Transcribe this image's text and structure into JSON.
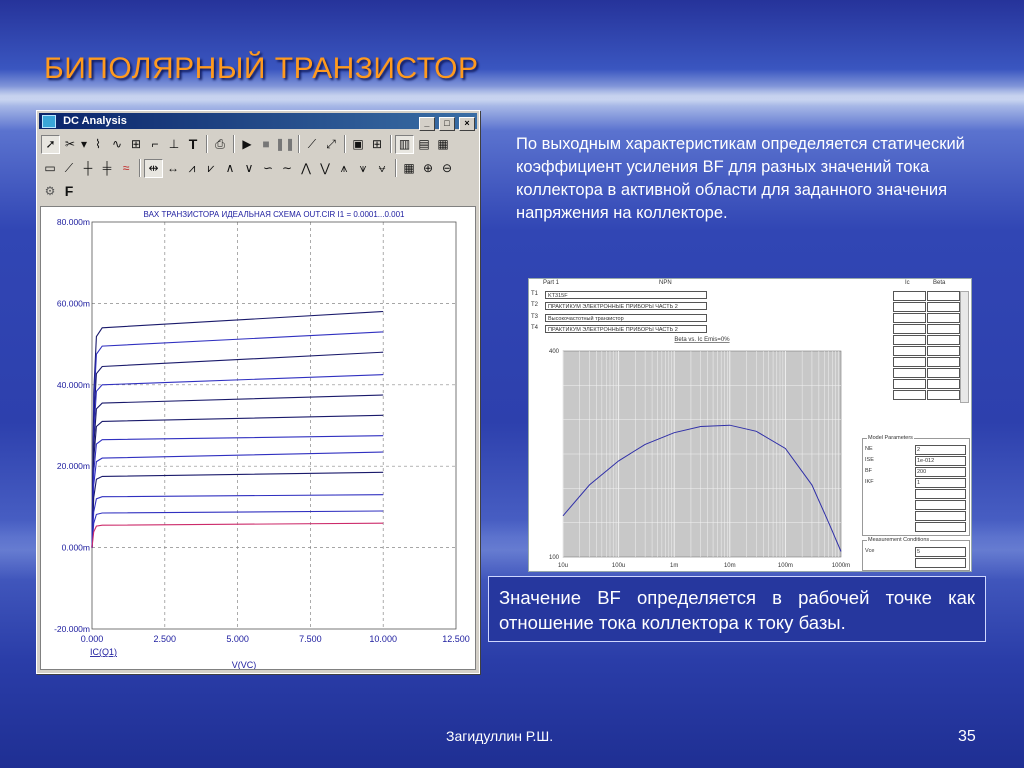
{
  "slide": {
    "title": "БИПОЛЯРНЫЙ ТРАНЗИСТОР",
    "description": "По выходным характеристикам определяется статический коэффициент усиления BF для разных значений тока коллектора в активной области для заданного значения напряжения на коллекторе.",
    "conclusion": "Значение BF определяется в рабочей точке как отношение тока коллектора к току базы.",
    "author": "Загидуллин Р.Ш.",
    "page_number": "35",
    "colors": {
      "title": "#ff9a1e",
      "text": "#ffffff",
      "panel_bg": "#26379e"
    }
  },
  "dc_window": {
    "title": "DC Analysis",
    "window_buttons": [
      "_",
      "□",
      "×"
    ],
    "toolbar1_icons": [
      "select-arrow-icon",
      "scissors-icon",
      "dropdown-arrow-icon",
      "curve-zoom-icon",
      "wave-icon",
      "graph-icon",
      "cursor-tool-icon",
      "node-tool-icon",
      "text-tool-icon",
      "print-icon",
      "run-icon",
      "stop-icon",
      "pause-icon",
      "slope-line-icon",
      "slope-line2-icon",
      "frame-icon",
      "grid-icon",
      "columns-icon",
      "rows-icon",
      "table-icon"
    ],
    "toolbar2_icons": [
      "rect-tool-icon",
      "tangent-icon",
      "peak-icon",
      "valley-icon",
      "magnet-icon",
      "cursor-left-icon",
      "cursor-both-icon",
      "high-icon",
      "low-icon",
      "peak2-icon",
      "valley2-icon",
      "wave-up-icon",
      "wave-down-icon",
      "slope-icon",
      "spread-icon",
      "inflect-icon",
      "inflect2-icon",
      "inflect3-icon",
      "table2-icon",
      "zoom-in-icon",
      "zoom-out-icon"
    ],
    "toolbar3_icons": [
      "gear-icon"
    ],
    "toolbar3_label": "F",
    "plot_title": "ВАХ ТРАНЗИСТОРА ИДЕАЛЬНАЯ СХЕМА OUT.CIR I1 = 0.0001...0.001"
  },
  "chart_data": [
    {
      "type": "line",
      "title": "ВАХ ТРАНЗИСТОРА ИДЕАЛЬНАЯ СХЕМА OUT.CIR I1 = 0.0001...0.001",
      "xlabel": "V(VC)",
      "ylabel": "IC(Q1)",
      "xlim": [
        0,
        12.5
      ],
      "ylim": [
        -0.02,
        0.08
      ],
      "x_ticks": [
        "0.000",
        "2.500",
        "5.000",
        "7.500",
        "10.000",
        "12.500"
      ],
      "y_ticks": [
        "80.000m",
        "60.000m",
        "40.000m",
        "20.000m",
        "0.000m",
        "-20.000m"
      ],
      "grid": true,
      "series": [
        {
          "knee": 0.054,
          "end": 0.058,
          "color": "#1a1a6b"
        },
        {
          "knee": 0.0495,
          "end": 0.053,
          "color": "#3030c0"
        },
        {
          "knee": 0.0445,
          "end": 0.048,
          "color": "#1a1a6b"
        },
        {
          "knee": 0.04,
          "end": 0.0425,
          "color": "#3030c0"
        },
        {
          "knee": 0.0355,
          "end": 0.0375,
          "color": "#1a1a6b"
        },
        {
          "knee": 0.031,
          "end": 0.0325,
          "color": "#1a1a6b"
        },
        {
          "knee": 0.0265,
          "end": 0.0275,
          "color": "#3030c0"
        },
        {
          "knee": 0.022,
          "end": 0.0235,
          "color": "#3030c0"
        },
        {
          "knee": 0.0175,
          "end": 0.0185,
          "color": "#1a1a6b"
        },
        {
          "knee": 0.0125,
          "end": 0.013,
          "color": "#3030c0"
        },
        {
          "knee": 0.0085,
          "end": 0.009,
          "color": "#3030c0"
        },
        {
          "knee": 0.0055,
          "end": 0.006,
          "color": "#cc2a6a"
        }
      ]
    },
    {
      "type": "line",
      "title": "Beta vs. Ic Emis=0%",
      "xscale": "log",
      "x_ticks": [
        "10u",
        "100u",
        "1m",
        "10m",
        "100m",
        "1000m"
      ],
      "y_ticks": [
        "400",
        "100"
      ],
      "xlim": [
        1e-05,
        1
      ],
      "ylim": [
        100,
        400
      ],
      "grid": true,
      "series": [
        {
          "points": [
            [
              1e-05,
              160
            ],
            [
              3e-05,
              205
            ],
            [
              0.0001,
              240
            ],
            [
              0.0003,
              264
            ],
            [
              0.001,
              281
            ],
            [
              0.003,
              290
            ],
            [
              0.01,
              292
            ],
            [
              0.03,
              283
            ],
            [
              0.1,
              258
            ],
            [
              0.3,
              205
            ],
            [
              0.6,
              150
            ],
            [
              1,
              108
            ]
          ]
        }
      ]
    }
  ],
  "model_window": {
    "part_label": "Part 1",
    "part_type": "NPN",
    "ic_header": "Ic",
    "beta_header": "Beta",
    "rows": [
      {
        "label": "T1",
        "value": "KT315F"
      },
      {
        "label": "T2",
        "value": "ПРАКТИКУМ ЭЛЕКТРОННЫЕ ПРИБОРЫ ЧАСТЬ 2"
      },
      {
        "label": "T3",
        "value": "Высокочастотный транзистор"
      },
      {
        "label": "T4",
        "value": "ПРАКТИКУМ ЭЛЕКТРОННЫЕ ПРИБОРЫ ЧАСТЬ 2"
      }
    ],
    "model_params_title": "Model Parameters",
    "params": [
      {
        "name": "NE",
        "value": "2"
      },
      {
        "name": "ISE",
        "value": "1e-012"
      },
      {
        "name": "BF",
        "value": "200"
      },
      {
        "name": "IKF",
        "value": "1"
      }
    ],
    "meas_title": "Measurement Conditions",
    "meas": [
      {
        "name": "Vce",
        "value": "5"
      }
    ]
  }
}
